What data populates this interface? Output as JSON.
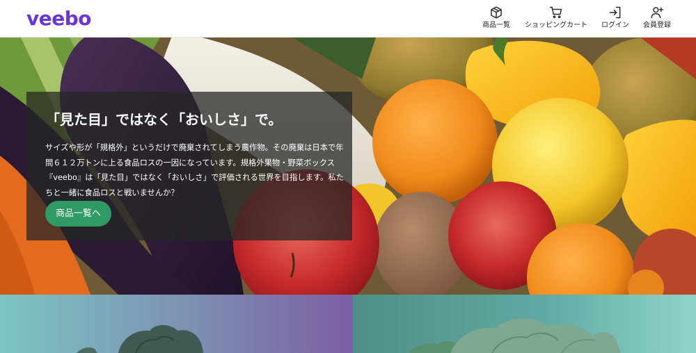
{
  "brand": {
    "name": "veebo",
    "color": "#6a35d9"
  },
  "nav": {
    "items": [
      {
        "label": "商品一覧",
        "icon": "box-icon"
      },
      {
        "label": "ショッピングカート",
        "icon": "cart-icon"
      },
      {
        "label": "ログイン",
        "icon": "login-icon"
      },
      {
        "label": "会員登録",
        "icon": "user-plus-icon"
      }
    ]
  },
  "hero": {
    "title": "「見た目」ではなく「おいしさ」で。",
    "description_lines": [
      "サイズや形が「規格外」というだけで廃棄されてしまう農作物。その廃棄は日本で年",
      "間６１２万トンに上る食品ロスの一因になっています。規格外果物・野菜ボックス",
      "『veebo』は「見た目」ではなく「おいしさ」で評価される世界を目指します。私た",
      "ちと一緒に食品ロスと戦いませんか？"
    ],
    "button_label": "商品一覧へ",
    "button_color": "#2f9a64"
  }
}
